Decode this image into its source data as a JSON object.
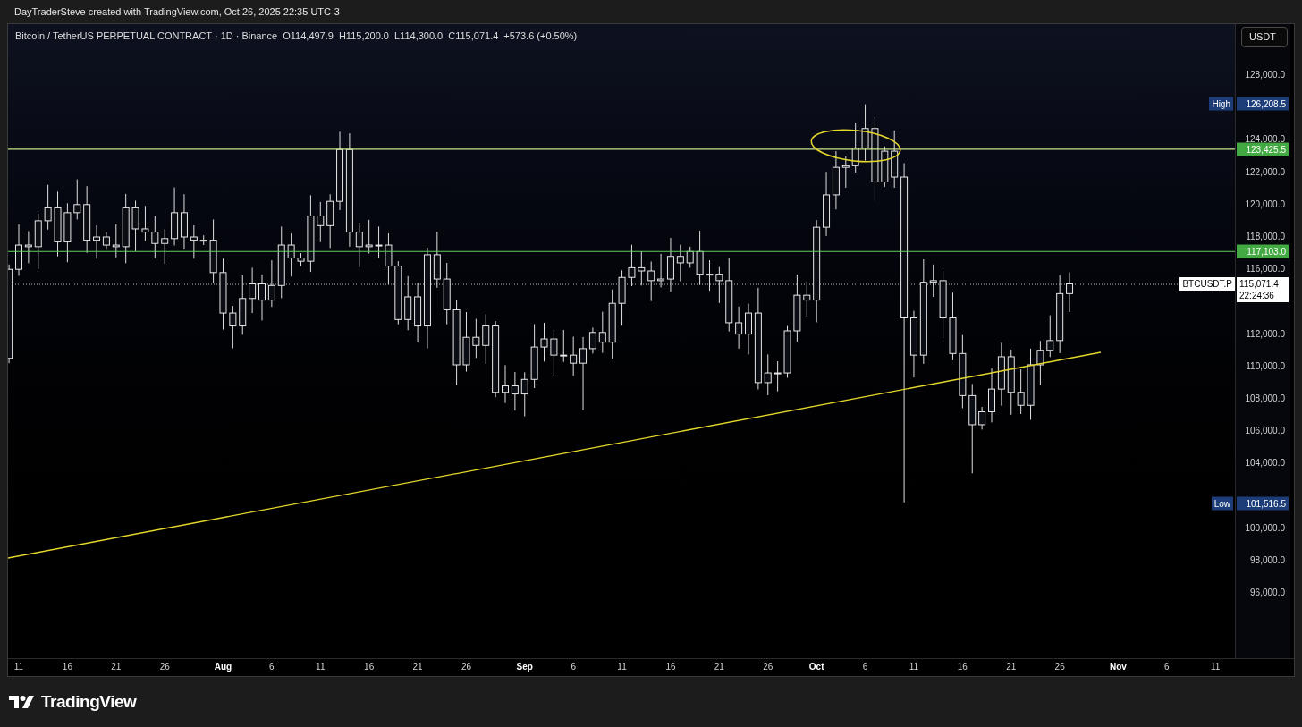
{
  "header": {
    "credit": "DayTraderSteve created with TradingView.com, Oct 26, 2025 22:35 UTC-3"
  },
  "legend": {
    "title": "Bitcoin / TetherUS PERPETUAL CONTRACT · 1D · Binance",
    "open": "O114,497.9",
    "high": "H115,200.0",
    "low": "L114,300.0",
    "close": "C115,071.4",
    "change": "+573.6 (+0.50%)"
  },
  "currency_button": "USDT",
  "price_axis": {
    "ticks": [
      "128,000.0",
      "124,000.0",
      "122,000.0",
      "120,000.0",
      "118,000.0",
      "116,000.0",
      "112,000.0",
      "110,000.0",
      "108,000.0",
      "106,000.0",
      "104,000.0",
      "100,000.0",
      "98,000.0",
      "96,000.0"
    ]
  },
  "markers": [
    {
      "kind": "high",
      "label": "High",
      "value": "126,208.5"
    },
    {
      "kind": "level",
      "value": "123,425.5"
    },
    {
      "kind": "level",
      "value": "117,103.0"
    },
    {
      "kind": "low",
      "label": "Low",
      "value": "101,516.5"
    }
  ],
  "last_price": {
    "symbol": "BTCUSDT.P",
    "price": "115,071.4",
    "countdown": "22:24:36"
  },
  "time_axis": [
    {
      "text": "11",
      "kind": "day"
    },
    {
      "text": "16",
      "kind": "day"
    },
    {
      "text": "21",
      "kind": "day"
    },
    {
      "text": "26",
      "kind": "day"
    },
    {
      "text": "Aug",
      "kind": "month"
    },
    {
      "text": "6",
      "kind": "day"
    },
    {
      "text": "11",
      "kind": "day"
    },
    {
      "text": "16",
      "kind": "day"
    },
    {
      "text": "21",
      "kind": "day"
    },
    {
      "text": "26",
      "kind": "day"
    },
    {
      "text": "Sep",
      "kind": "month"
    },
    {
      "text": "6",
      "kind": "day"
    },
    {
      "text": "11",
      "kind": "day"
    },
    {
      "text": "16",
      "kind": "day"
    },
    {
      "text": "21",
      "kind": "day"
    },
    {
      "text": "26",
      "kind": "day"
    },
    {
      "text": "Oct",
      "kind": "month"
    },
    {
      "text": "6",
      "kind": "day"
    },
    {
      "text": "11",
      "kind": "day"
    },
    {
      "text": "16",
      "kind": "day"
    },
    {
      "text": "21",
      "kind": "day"
    },
    {
      "text": "26",
      "kind": "day"
    },
    {
      "text": "Nov",
      "kind": "month"
    },
    {
      "text": "6",
      "kind": "day"
    },
    {
      "text": "11",
      "kind": "day"
    }
  ],
  "footer": {
    "logo": "TradingView"
  }
}
